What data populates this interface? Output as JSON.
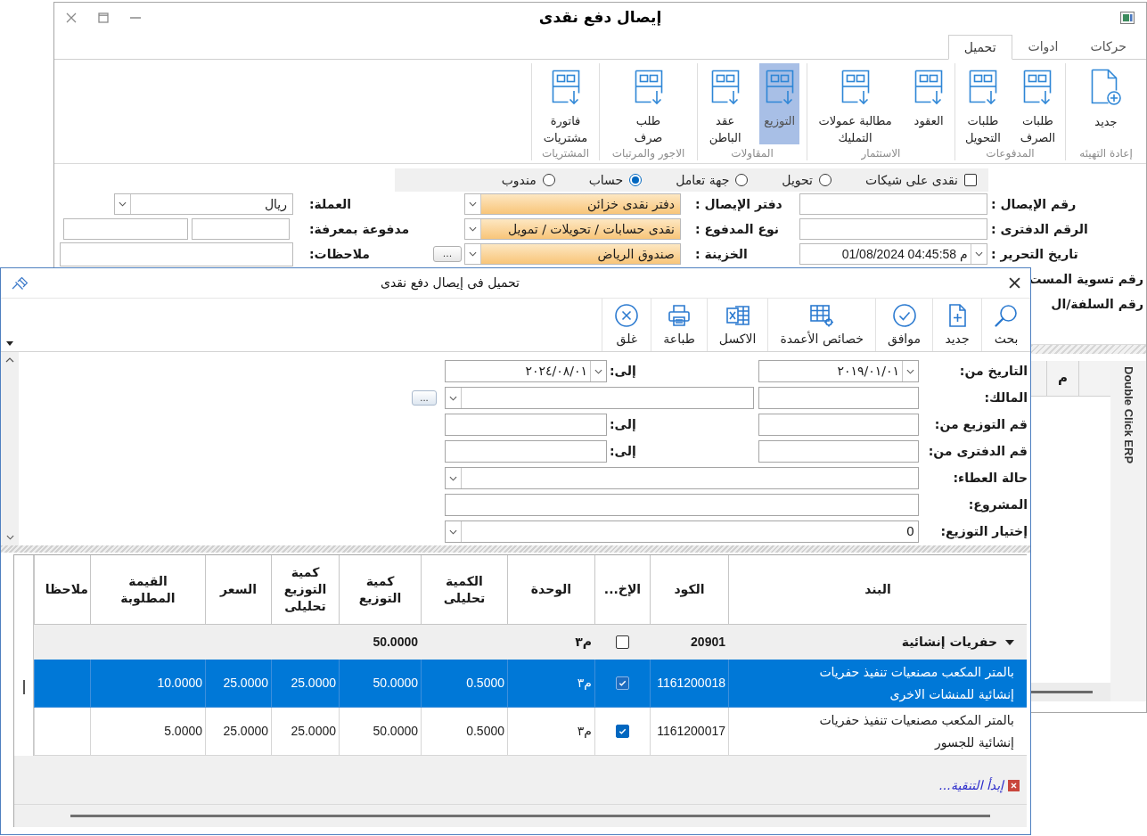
{
  "main_window": {
    "title": "إيصال دفع نقدى",
    "tabs": [
      {
        "label": "حركات",
        "selected": false
      },
      {
        "label": "ادوات",
        "selected": false
      },
      {
        "label": "تحميل",
        "selected": true
      }
    ],
    "ribbon_groups": [
      {
        "label": "إعادة التهيئه",
        "buttons": [
          {
            "label": "جديد",
            "kind": "new",
            "selected": false
          }
        ]
      },
      {
        "label": "المدفوعات",
        "buttons": [
          {
            "label": "طلبات\nالصرف",
            "kind": "load",
            "selected": false
          },
          {
            "label": "طلبات\nالتحويل",
            "kind": "load",
            "selected": false
          }
        ]
      },
      {
        "label": "الاستثمار",
        "buttons": [
          {
            "label": "العقود",
            "kind": "load",
            "selected": false
          },
          {
            "label": "مطالبة عمولات\nالتمليك",
            "kind": "load",
            "selected": false
          }
        ]
      },
      {
        "label": "المقاولات",
        "buttons": [
          {
            "label": "التوزيع",
            "kind": "load",
            "selected": true
          },
          {
            "label": "عقد\nالباطن",
            "kind": "load",
            "selected": false
          }
        ]
      },
      {
        "label": "الاجور والمرتبات",
        "buttons": [
          {
            "label": "طلب\nصرف",
            "kind": "load",
            "selected": false
          }
        ]
      },
      {
        "label": "المشتريات",
        "buttons": [
          {
            "label": "فاتورة\nمشتريات",
            "kind": "load",
            "selected": false
          }
        ]
      }
    ],
    "options": [
      {
        "kind": "checkbox",
        "label": "نقدى على شيكات",
        "checked": false
      },
      {
        "kind": "radio",
        "label": "تحويل",
        "selected": false
      },
      {
        "kind": "radio",
        "label": "جهة تعامل",
        "selected": false
      },
      {
        "kind": "radio",
        "label": "حساب",
        "selected": true
      },
      {
        "kind": "radio",
        "label": "مندوب",
        "selected": false
      }
    ],
    "form_rows": [
      [
        {
          "label": "رقم الإيصال :",
          "kind": "text"
        },
        {
          "label": "دفتر الإيصال :",
          "kind": "select",
          "value": "دفتر نقدى خزائن",
          "highlighted": true
        },
        {
          "label": "العملة:",
          "kind": "select",
          "value": "ريال",
          "highlighted": false
        }
      ],
      [
        {
          "label": "الرقم الدفترى :",
          "kind": "text"
        },
        {
          "label": "نوع المدفوع :",
          "kind": "select",
          "value": "نقدى حسابات / تحويلات / تمويل",
          "highlighted": true
        },
        {
          "label": "مدفوعة بمعرفة:",
          "kind": "text_pair"
        }
      ],
      [
        {
          "label": "تاريخ التحرير :",
          "kind": "datetime",
          "value": "01/08/2024 04:45:58 م"
        },
        {
          "label": "الخزينة :",
          "kind": "select",
          "value": "صندوق الرياض",
          "highlighted": true,
          "button": "..."
        },
        {
          "label": "ملاحظات:",
          "kind": "textarea"
        }
      ],
      [
        {
          "label": "رقم تسوية المست",
          "kind": "cut_label"
        }
      ],
      [
        {
          "label": "رقم السلفة/ال",
          "kind": "cut_label"
        }
      ]
    ],
    "side_grid": {
      "columns": [
        "م"
      ]
    },
    "side_tab": "Double Click ERP"
  },
  "dialog": {
    "title": "تحميل فى إيصال دفع نقدى",
    "toolbar": [
      {
        "label": "بحث",
        "kind": "search"
      },
      {
        "label": "جديد",
        "kind": "new"
      },
      {
        "label": "موافق",
        "kind": "ok"
      },
      {
        "label": "خصائص الأعمدة",
        "kind": "columns"
      },
      {
        "label": "الاكسل",
        "kind": "excel"
      },
      {
        "label": "طباعة",
        "kind": "print"
      },
      {
        "label": "غلق",
        "kind": "close"
      }
    ],
    "filters": [
      {
        "label": "التاريخ من:",
        "kind": "date_range",
        "from": "٢٠١٩/٠١/٠١",
        "to_label": "إلى:",
        "to": "٢٠٢٤/٠٨/٠١"
      },
      {
        "label": "المالك:",
        "kind": "text_select",
        "button": "..."
      },
      {
        "label": "قم التوزيع من:",
        "kind": "range",
        "to_label": "إلى:"
      },
      {
        "label": "قم الدفترى من:",
        "kind": "range",
        "to_label": "إلى:"
      },
      {
        "label": "حالة العطاء:",
        "kind": "select"
      },
      {
        "label": "المشروع:",
        "kind": "text"
      },
      {
        "label": "إختيار التوزيع:",
        "kind": "select",
        "value": "0"
      }
    ],
    "grid": {
      "columns": [
        "البند",
        "الكود",
        "الإخ...",
        "الوحدة",
        "الكمية\nتحليلى",
        "كمية\nالتوزيع",
        "كمية\nالتوزيع\nتحليلى",
        "السعر",
        "القيمة\nالمطلوبة",
        "ملاحظا"
      ],
      "rows": [
        {
          "kind": "group",
          "selected": false,
          "expanded": true,
          "title": "حفريات إنشائية",
          "code": "20901",
          "checked": false,
          "unit": "م٣",
          "distribution_qty": "50.0000"
        },
        {
          "kind": "item",
          "selected": true,
          "item": "بالمتر المكعب مصنعيات تنفيذ حفريات\nإنشائية للمنشات الاخرى",
          "code": "1161200018",
          "checked": true,
          "unit": "م٣",
          "qty_analytic": "0.5000",
          "distribution_qty": "50.0000",
          "distribution_qty_analytic": "25.0000",
          "price": "25.0000",
          "required_value": "10.0000"
        },
        {
          "kind": "item",
          "selected": false,
          "item": "بالمتر المكعب مصنعيات تنفيذ حفريات\nإنشائية للجسور",
          "code": "1161200017",
          "checked": true,
          "unit": "م٣",
          "qty_analytic": "0.5000",
          "distribution_qty": "50.0000",
          "distribution_qty_analytic": "25.0000",
          "price": "25.0000",
          "required_value": "5.0000"
        }
      ]
    },
    "filter_link": "إبدأ التنقية..."
  }
}
